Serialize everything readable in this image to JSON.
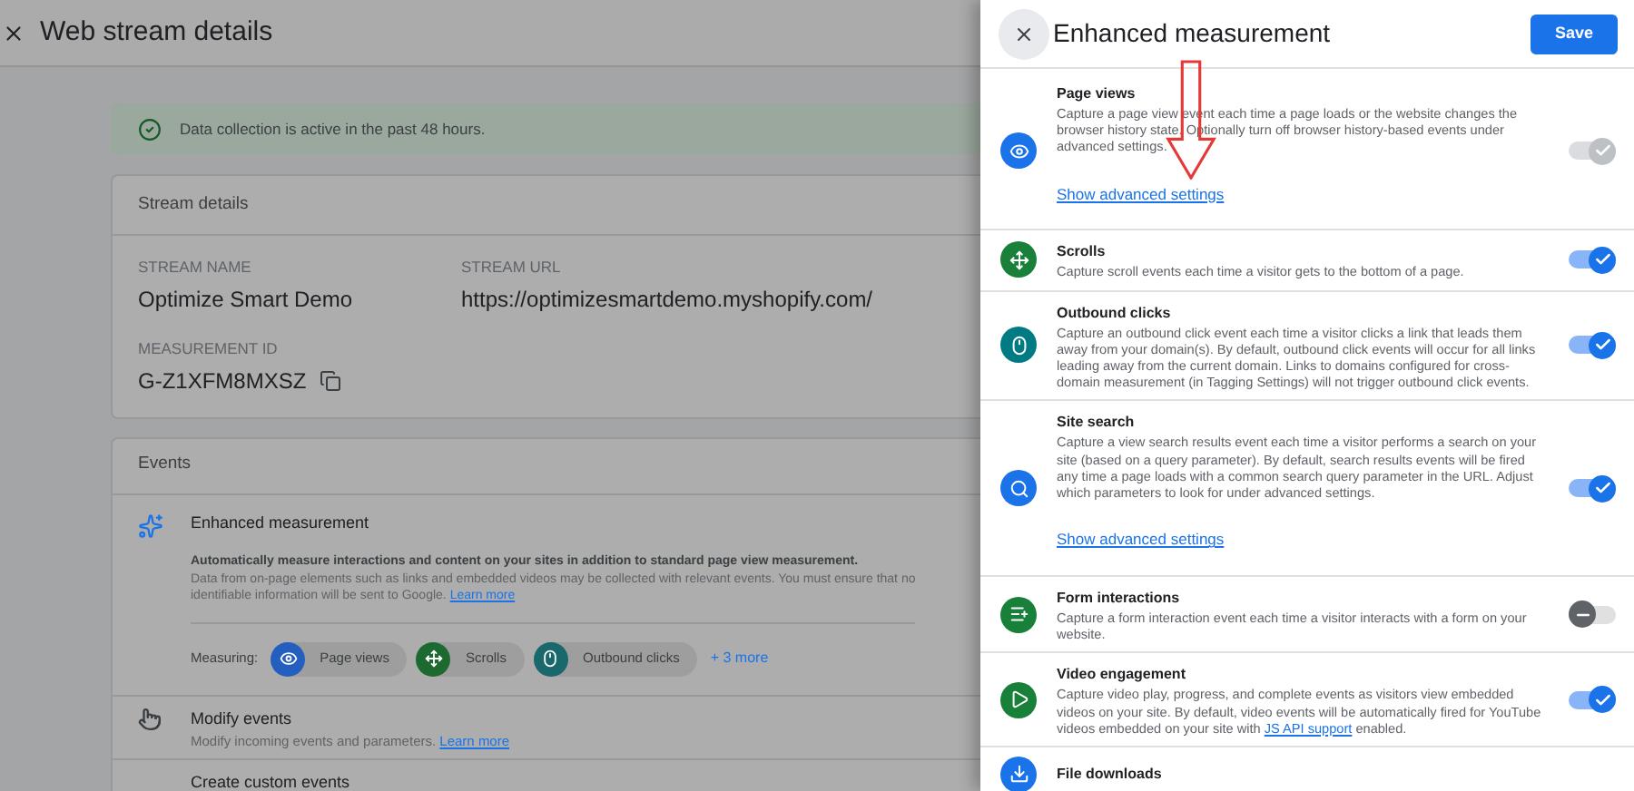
{
  "page": {
    "title": "Web stream details",
    "banner": "Data collection is active in the past 48 hours.",
    "stream_details": {
      "heading": "Stream details",
      "fields": [
        {
          "label": "STREAM NAME",
          "value": "Optimize Smart Demo"
        },
        {
          "label": "STREAM URL",
          "value": "https://optimizesmartdemo.myshopify.com/"
        }
      ],
      "measurement_id": {
        "label": "MEASUREMENT ID",
        "value": "G-Z1XFM8MXSZ"
      }
    },
    "events": {
      "heading": "Events",
      "enhanced": {
        "title": "Enhanced measurement",
        "summary": "Automatically measure interactions and content on your sites in addition to standard page view measurement.",
        "description": "Data from on-page elements such as links and embedded videos may be collected with relevant events. You must ensure that no",
        "description_line2": "identifiable information will be sent to Google.",
        "link": "Learn more",
        "measuring_label": "Measuring:",
        "chips": [
          {
            "kind": "eye",
            "label": "Page views",
            "color": "#245fc0"
          },
          {
            "kind": "scroll",
            "label": "Scrolls",
            "color": "#1d6a31"
          },
          {
            "kind": "mouse",
            "label": "Outbound clicks",
            "color": "#19686c"
          }
        ],
        "more": "+ 3 more"
      },
      "rows": [
        {
          "kind": "hand",
          "title": "Modify events",
          "description": "Modify incoming events and parameters.",
          "link": "Learn more"
        },
        {
          "kind": "none",
          "title": "Create custom events"
        }
      ]
    }
  },
  "panel": {
    "title": "Enhanced measurement",
    "save": "Save",
    "items": [
      {
        "kind": "eye",
        "color": "#1a73e8",
        "title": "Page views",
        "description": "Capture a page view event each time a page loads or the website changes the browser history state. Optionally turn off browser history-based events under advanced settings.",
        "link": "Show advanced settings",
        "on": true,
        "disabled": true
      },
      {
        "kind": "scroll",
        "color": "#188038",
        "title": "Scrolls",
        "description": "Capture scroll events each time a visitor gets to the bottom of a page.",
        "on": true,
        "disabled": false
      },
      {
        "kind": "mouse",
        "color": "#007b83",
        "title": "Outbound clicks",
        "description": "Capture an outbound click event each time a visitor clicks a link that leads them away from your domain(s). By default, outbound click events will occur for all links leading away from the current domain. Links to domains configured for cross-domain measurement (in Tagging Settings) will not trigger outbound click events.",
        "on": true,
        "disabled": false
      },
      {
        "kind": "search",
        "color": "#1a73e8",
        "title": "Site search",
        "description": "Capture a view search results event each time a visitor performs a search on your site (based on a query parameter). By default, search results events will be fired any time a page loads with a common search query parameter in the URL. Adjust which parameters to look for under advanced settings.",
        "link": "Show advanced settings",
        "on": true,
        "disabled": false
      },
      {
        "kind": "form",
        "color": "#188038",
        "title": "Form interactions",
        "description": "Capture a form interaction event each time a visitor interacts with a form on your website.",
        "on": false,
        "disabled": false
      },
      {
        "kind": "play",
        "color": "#188038",
        "title": "Video engagement",
        "description": "Capture video play, progress, and complete events as visitors view embedded videos on your site. By default, video events will be automatically fired for YouTube videos embedded on your site with",
        "inline_link": "JS API support",
        "description_end": "enabled.",
        "on": true,
        "disabled": false
      },
      {
        "kind": "download",
        "color": "#1a73e8",
        "title": "File downloads"
      }
    ]
  }
}
